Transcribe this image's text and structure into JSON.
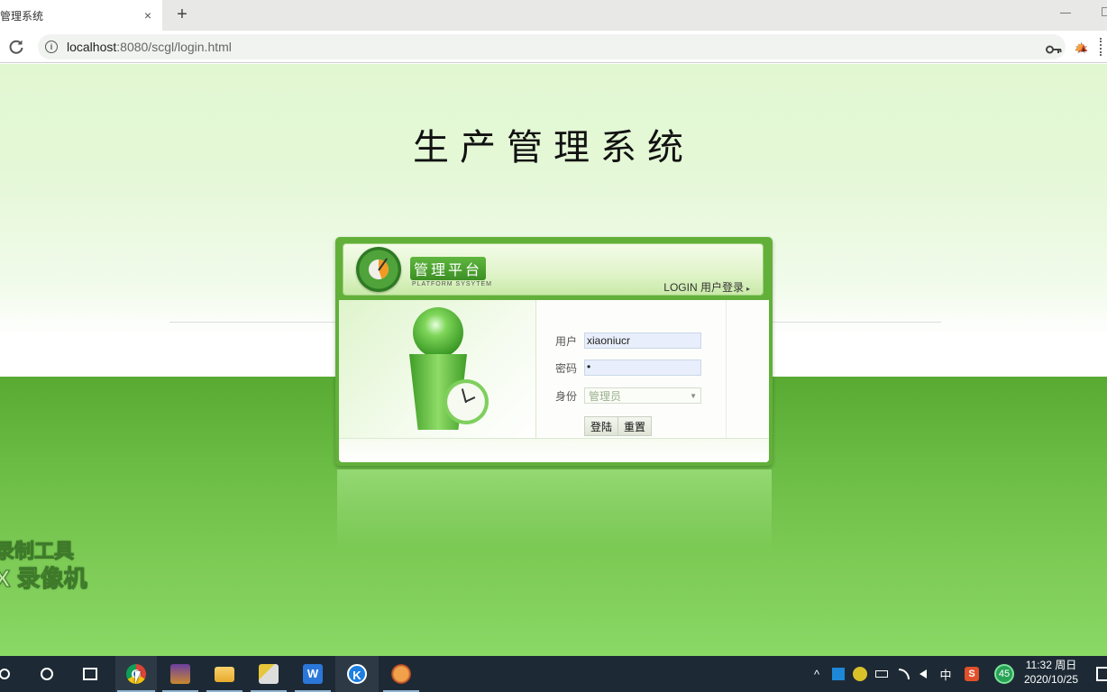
{
  "browser": {
    "tab_title": "管理系统",
    "tab_close": "×",
    "new_tab": "+",
    "url_host": "localhost",
    "url_rest": ":8080/scgl/login.html",
    "info_icon": "i",
    "star_icon": "☆",
    "ext_icon": "⛺"
  },
  "page": {
    "title": "生产管理系统",
    "watermark_line1": "录制工具",
    "watermark_line2": "X 录像机"
  },
  "login": {
    "platform_badge": "管理平台",
    "platform_sub": "PLATFORM SYSYTEM",
    "login_label": "LOGIN 用户登录",
    "login_arrow": "▸",
    "username_label": "用户",
    "username_value": "xiaoniucr",
    "password_label": "密码",
    "password_value": "•",
    "role_label": "身份",
    "role_selected": "管理员",
    "role_chevron": "▼",
    "login_button": "登陆",
    "reset_button": "重置"
  },
  "taskbar": {
    "apps": [
      {
        "name": "chrome",
        "active": true
      },
      {
        "name": "eclipse-ide",
        "active": false
      },
      {
        "name": "file-explorer",
        "active": false
      },
      {
        "name": "tools",
        "active": false
      },
      {
        "name": "wps-office",
        "label": "W",
        "active": false
      },
      {
        "name": "kugou",
        "label": "K",
        "active": true
      },
      {
        "name": "fox-app",
        "active": false
      }
    ],
    "tray": {
      "chevron": "^",
      "ime": "中",
      "sogou": "S",
      "badge": "45",
      "time": "11:32 周日",
      "date": "2020/10/25"
    }
  },
  "colors": {
    "accent_green": "#62b03a",
    "ground_green": "#58aa33",
    "taskbar": "#1d2a35"
  }
}
